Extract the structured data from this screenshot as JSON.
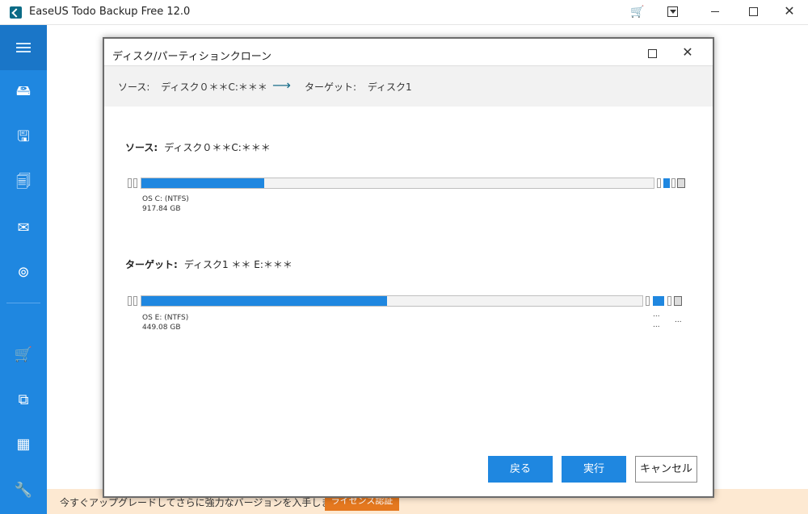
{
  "app": {
    "title": "EaseUS Todo Backup Free 12.0"
  },
  "sidebar": {
    "items": [
      {
        "name": "disk-backup"
      },
      {
        "name": "system-backup"
      },
      {
        "name": "file-backup"
      },
      {
        "name": "mail-backup"
      },
      {
        "name": "smart-backup"
      },
      {
        "name": "cart"
      },
      {
        "name": "clone"
      },
      {
        "name": "tools"
      },
      {
        "name": "settings"
      }
    ]
  },
  "upgrade_bar": {
    "text": "今すぐアップグレードしてさらに強力なバージョンを入手しましょう。",
    "license_button": "ライセンス認証"
  },
  "dialog": {
    "title": "ディスク/パーティションクローン",
    "summary": {
      "source_label": "ソース:",
      "source_value": "ディスク０＊＊C:＊＊＊",
      "arrow": "⟶",
      "target_label": "ターゲット:",
      "target_value": "ディスク1"
    },
    "source": {
      "heading": "ソース:",
      "disk": "ディスク０＊＊C:＊＊＊",
      "partition_name": "OS C: (NTFS)",
      "partition_size": "917.84 GB",
      "fill_fraction": 0.24
    },
    "target": {
      "heading": "ターゲット:",
      "disk": "ディスク1 ＊＊ E:＊＊＊",
      "partition_name": "OS E: (NTFS)",
      "partition_size": "449.08 GB",
      "fill_fraction": 0.49,
      "trailing": "..."
    },
    "buttons": {
      "back": "戻る",
      "execute": "実行",
      "cancel": "キャンセル"
    }
  },
  "colors": {
    "accent": "#1f87e0",
    "sidebar": "#1f87e0",
    "upgrade_bg": "#fde9d2",
    "license_btn": "#e5781f"
  }
}
